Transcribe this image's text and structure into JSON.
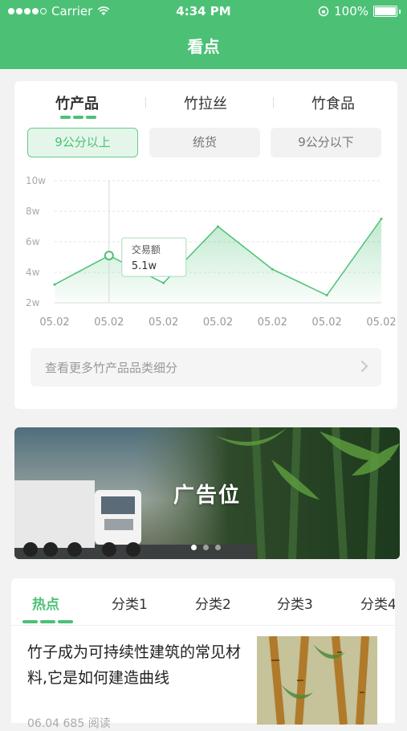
{
  "status_bar": {
    "carrier": "Carrier",
    "time": "4:34 PM",
    "battery": "100%"
  },
  "nav": {
    "title": "看点"
  },
  "product_tabs": [
    {
      "label": "竹产品",
      "active": true
    },
    {
      "label": "竹拉丝",
      "active": false
    },
    {
      "label": "竹食品",
      "active": false
    }
  ],
  "filters": [
    {
      "label": "9公分以上",
      "active": true
    },
    {
      "label": "统货",
      "active": false
    },
    {
      "label": "9公分以下",
      "active": false
    }
  ],
  "chart_data": {
    "type": "area",
    "x": [
      "05.02",
      "05.02",
      "05.02",
      "05.02",
      "05.02",
      "05.02",
      "05.02"
    ],
    "y_ticks": [
      "2w",
      "4w",
      "6w",
      "8w",
      "10w"
    ],
    "ylim": [
      2,
      10
    ],
    "points": [
      {
        "x": 0,
        "y": 3.2
      },
      {
        "x": 1,
        "y": 5.1
      },
      {
        "x": 2,
        "y": 3.3
      },
      {
        "x": 3,
        "y": 7.0
      },
      {
        "x": 4,
        "y": 4.2
      },
      {
        "x": 5,
        "y": 2.5
      },
      {
        "x": 6,
        "y": 7.5
      }
    ],
    "highlight_index": 1,
    "tooltip": {
      "label": "交易额",
      "value": "5.1w"
    },
    "grid": true,
    "color": "#4cc176"
  },
  "more_link": {
    "label": "查看更多竹产品品类细分"
  },
  "banner": {
    "text": "广告位",
    "pages": 3,
    "current_page": 0
  },
  "category_tabs": [
    {
      "label": "热点",
      "active": true
    },
    {
      "label": "分类1",
      "active": false
    },
    {
      "label": "分类2",
      "active": false
    },
    {
      "label": "分类3",
      "active": false
    },
    {
      "label": "分类4",
      "active": false
    }
  ],
  "article": {
    "title": "竹子成为可持续性建筑的常见材料,它是如何建造曲线",
    "meta": "06.04   685 阅读"
  },
  "colors": {
    "primary": "#4cc176",
    "background": "#f2f2f2"
  }
}
